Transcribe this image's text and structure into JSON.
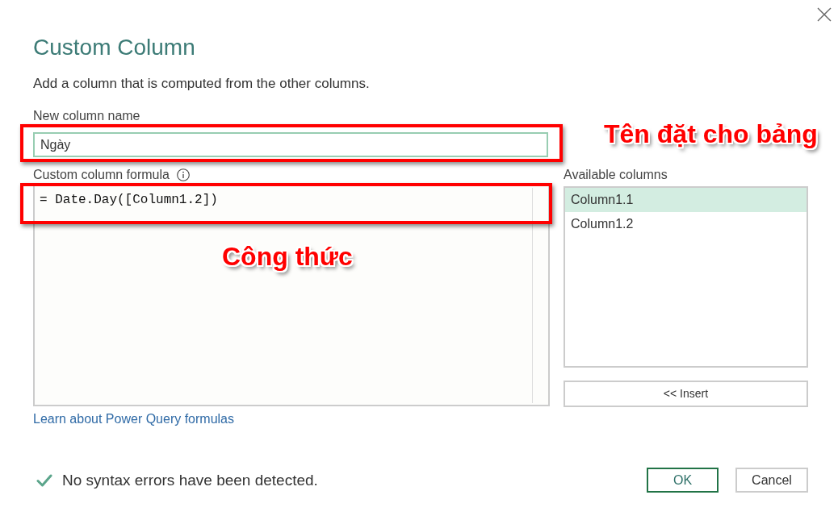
{
  "dialog": {
    "title": "Custom Column",
    "description": "Add a column that is computed from the other columns."
  },
  "new_column_name": {
    "label": "New column name",
    "value": "Ngày",
    "highlighted": true,
    "annotation": "Tên đặt cho bảng"
  },
  "formula": {
    "label": "Custom column formula",
    "value": "= Date.Day([Column1.2])",
    "highlighted": true,
    "annotation": "Công thức"
  },
  "help_link": "Learn about Power Query formulas",
  "available_columns": {
    "label": "Available columns",
    "items": [
      {
        "label": "Column1.1",
        "selected": true
      },
      {
        "label": "Column1.2",
        "selected": false
      }
    ],
    "insert_button": "<< Insert"
  },
  "status": {
    "valid": true,
    "text": "No syntax errors have been detected."
  },
  "buttons": [
    {
      "label": "OK",
      "kind": "primary"
    },
    {
      "label": "Cancel",
      "kind": "secondary"
    }
  ]
}
